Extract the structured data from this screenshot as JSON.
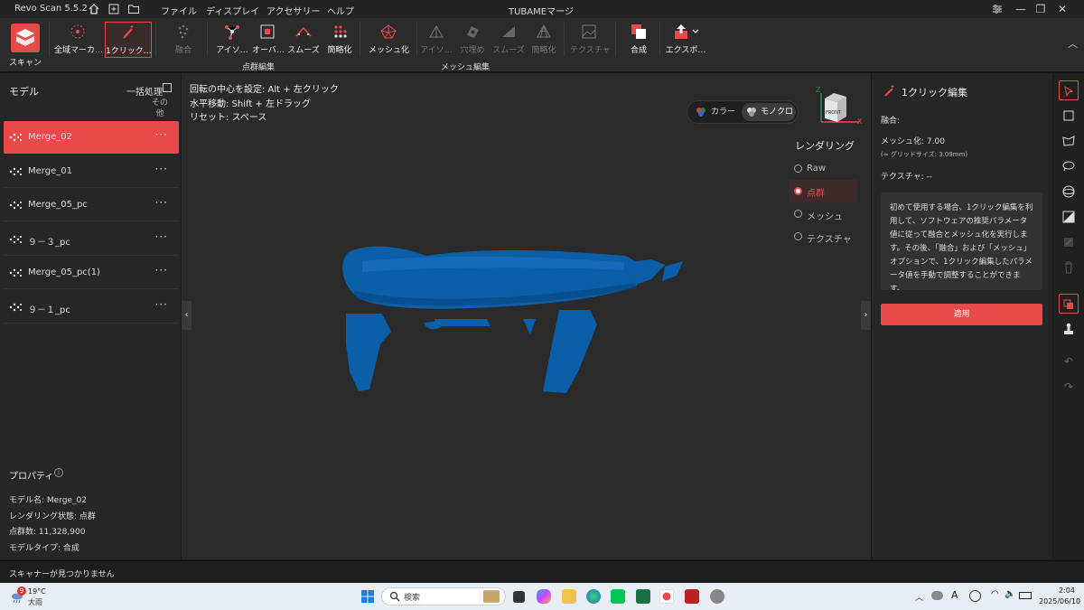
{
  "app": {
    "name": "Revo Scan 5.5.2",
    "project": "TUBAMEマージ"
  },
  "menu": [
    "ファイル",
    "ディスプレイ",
    "アクセサリー",
    "ヘルプ"
  ],
  "toolbar": {
    "scan": "スキャン",
    "global_marker": "全域マーカ…",
    "one_click": "1クリック…",
    "fuse": "融合",
    "isolate": "アイソ…",
    "overlap": "オーバ…",
    "smooth": "スムーズ",
    "simplify": "簡略化",
    "mesh": "メッシュ化",
    "mesh_isolate": "アイソ…",
    "hole_fill": "穴埋め",
    "mesh_smooth": "スムーズ",
    "mesh_simplify": "簡略化",
    "texture": "テクスチャ",
    "merge": "合成",
    "export": "エクスポ…",
    "group_point": "点群編集",
    "group_mesh": "メッシュ編集"
  },
  "left": {
    "title": "モデル",
    "batch": "一括処理",
    "other": "その他",
    "models": [
      {
        "name": "Merge_02",
        "active": true
      },
      {
        "name": "Merge_01",
        "active": false
      },
      {
        "name": "Merge_05_pc",
        "active": false
      },
      {
        "name": "９－３_pc",
        "active": false
      },
      {
        "name": "Merge_05_pc(1)",
        "active": false
      },
      {
        "name": "９－１_pc",
        "active": false
      }
    ],
    "properties_title": "プロパティ",
    "props": [
      "モデル名: Merge_02",
      "レンダリング状態: 点群",
      "点群数: 11,328,900",
      "モデルタイプ: 合成"
    ]
  },
  "viewport": {
    "hints": [
      "回転の中心を設定: Alt + 左クリック",
      "水平移動: Shift + 左ドラッグ",
      "リセット: スペース"
    ],
    "color_btn": "カラー",
    "mono_btn": "モノクロ",
    "axis_front": "FRONT",
    "axis_x": "X",
    "axis_z": "Z",
    "rendering_title": "レンダリング",
    "render_options": [
      "Raw",
      "点群",
      "メッシュ",
      "テクスチャ"
    ],
    "selected_render": "点群"
  },
  "right": {
    "title": "1クリック編集",
    "fuse_label": "融合:",
    "mesh_label": "メッシュ化: 7.00",
    "grid_label": "(≈ グリッドサイズ: 3.09mm)",
    "texture_label": "テクスチャ: --",
    "description": "初めて使用する場合、1クリック編集を利用して、ソフトウェアの推奨パラメータ値に従って融合とメッシュ化を実行します。その後、「融合」および「メッシュ」オプションで、1クリック編集したパラメータ値を手動で調整することができます。",
    "apply": "適用"
  },
  "status": "スキャナーが見つかりません",
  "taskbar": {
    "weather_temp": "19°C",
    "weather_desc": "大雨",
    "weather_badge": "9",
    "search": "検索",
    "time": "2:04",
    "date": "2025/06/10",
    "ime": "A"
  },
  "colors": {
    "accent": "#e84a4a",
    "model": "#0b5ea8"
  }
}
